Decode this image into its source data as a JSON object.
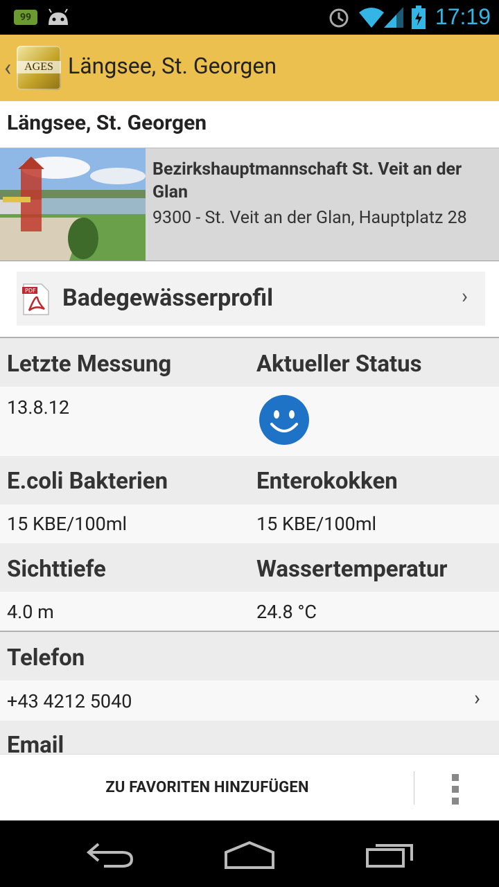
{
  "status_bar": {
    "battery_badge": "99",
    "time": "17:19"
  },
  "action_bar": {
    "logo_text": "AGES",
    "title": "Längsee, St. Georgen"
  },
  "location": {
    "title": "Längsee, St. Georgen",
    "authority_name": "Bezirkshauptmannschaft St. Veit an der Glan",
    "authority_address": "9300 - St. Veit an der Glan, Hauptplatz 28"
  },
  "profile_link": {
    "label": "Badegewässerprofil",
    "icon": "pdf-icon"
  },
  "measurements": {
    "last_measurement_label": "Letzte Messung",
    "last_measurement_value": "13.8.12",
    "current_status_label": "Aktueller Status",
    "current_status_icon": "smiley-icon",
    "ecoli_label": "E.coli Bakterien",
    "ecoli_value": "15 KBE/100ml",
    "enterococci_label": "Enterokokken",
    "enterococci_value": "15 KBE/100ml",
    "visibility_label": "Sichttiefe",
    "visibility_value": "4.0 m",
    "water_temp_label": "Wassertemperatur",
    "water_temp_value": "24.8 °C"
  },
  "contact": {
    "phone_label": "Telefon",
    "phone_value": "+43 4212 5040",
    "email_label": "Email"
  },
  "bottom_bar": {
    "favorite_button": "ZU FAVORITEN HINZUFÜGEN"
  },
  "colors": {
    "action_bar": "#ecc04e",
    "status_time": "#33b5e5",
    "smiley": "#1e73c6"
  }
}
